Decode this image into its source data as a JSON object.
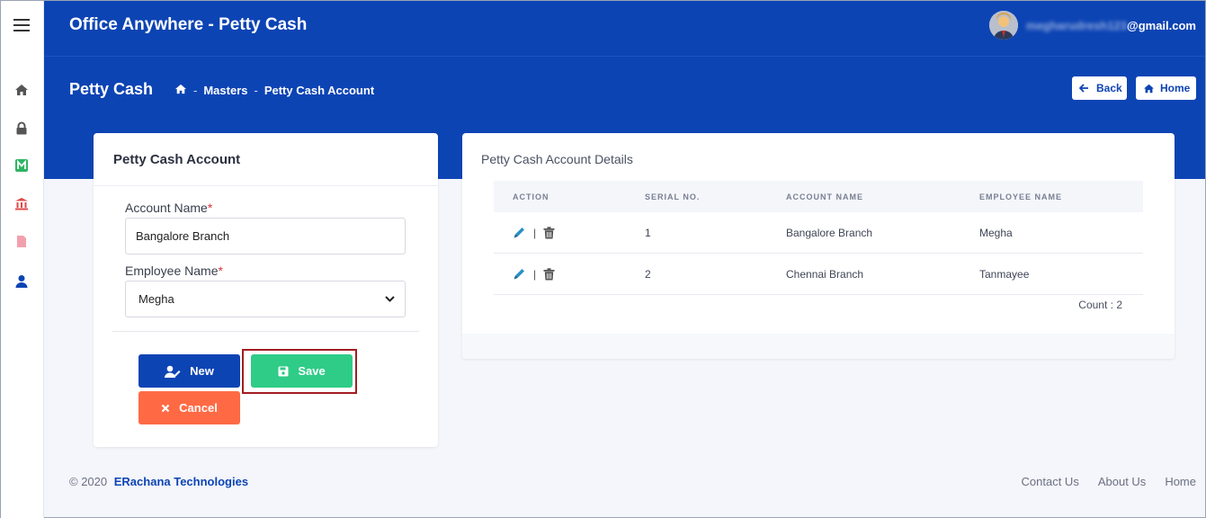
{
  "app": {
    "title": "Office Anywhere - Petty Cash"
  },
  "user": {
    "email_hidden": "megharudresh123",
    "email_domain": "@gmail.com"
  },
  "sidebar": {
    "icons": [
      "home-icon",
      "lock-icon",
      "m-logo-icon",
      "bank-icon",
      "file-icon",
      "user-icon"
    ]
  },
  "page": {
    "title": "Petty Cash",
    "breadcrumb": {
      "sep1": "-",
      "masters": "Masters",
      "sep2": "-",
      "current": "Petty Cash Account"
    },
    "back_label": "Back",
    "home_label": "Home"
  },
  "form": {
    "title": "Petty Cash Account",
    "account_name_label": "Account Name",
    "account_name_value": "Bangalore Branch",
    "employee_name_label": "Employee Name",
    "employee_name_value": "Megha",
    "required_mark": "*",
    "new_label": "New",
    "save_label": "Save",
    "cancel_label": "Cancel"
  },
  "details": {
    "title": "Petty Cash Account Details",
    "columns": [
      "ACTION",
      "SERIAL NO.",
      "ACCOUNT NAME",
      "EMPLOYEE NAME"
    ],
    "rows": [
      {
        "serial": "1",
        "account": "Bangalore Branch",
        "employee": "Megha"
      },
      {
        "serial": "2",
        "account": "Chennai Branch",
        "employee": "Tanmayee"
      }
    ],
    "action_sep": "|",
    "count_label": "Count : 2"
  },
  "footer": {
    "copyright": "© 2020",
    "company": "ERachana Technologies",
    "links": [
      "Contact Us",
      "About Us",
      "Home"
    ]
  },
  "colors": {
    "primary": "#0d44b4",
    "save": "#2ecc87",
    "cancel": "#ff6a45",
    "required": "#e0343a"
  }
}
